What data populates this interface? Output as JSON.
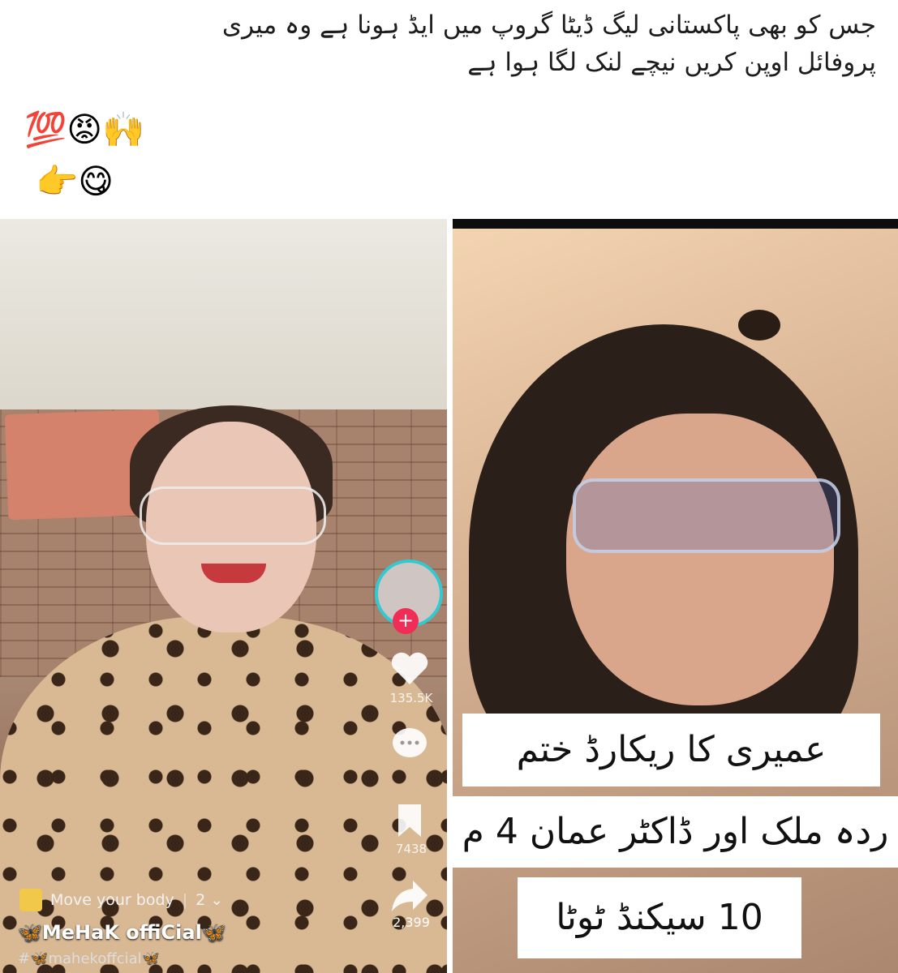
{
  "post": {
    "text_line1": "جس کو بھی پاکستانی لیگ ڈیٹا گروپ میں ایڈ ہونا ہے وہ میری",
    "text_line2": "پروفائل اوپن کریں نیچے لنک لگا ہوا ہے",
    "emoji_row1": "💯😡🙌",
    "emoji_row2": "👉😋"
  },
  "left_video": {
    "likes": "135.5K",
    "saves": "7438",
    "shares": "2,399",
    "music_label": "Move your body",
    "music_count": "2 ⌄",
    "username": "🦋MeHaK offiCial🦋",
    "hashtag": "#🦋mahekoffcial🦋"
  },
  "right_video": {
    "caption_line1": "عمیری کا ریکارڈ ختم",
    "caption_line2": "ردہ ملک اور ڈاکٹر عمان 4 م",
    "caption_line3": "10 سیکنڈ ٹوٹا"
  },
  "icons": {
    "heart": "heart-icon",
    "comment": "comment-icon",
    "bookmark": "bookmark-icon",
    "share": "share-icon"
  }
}
